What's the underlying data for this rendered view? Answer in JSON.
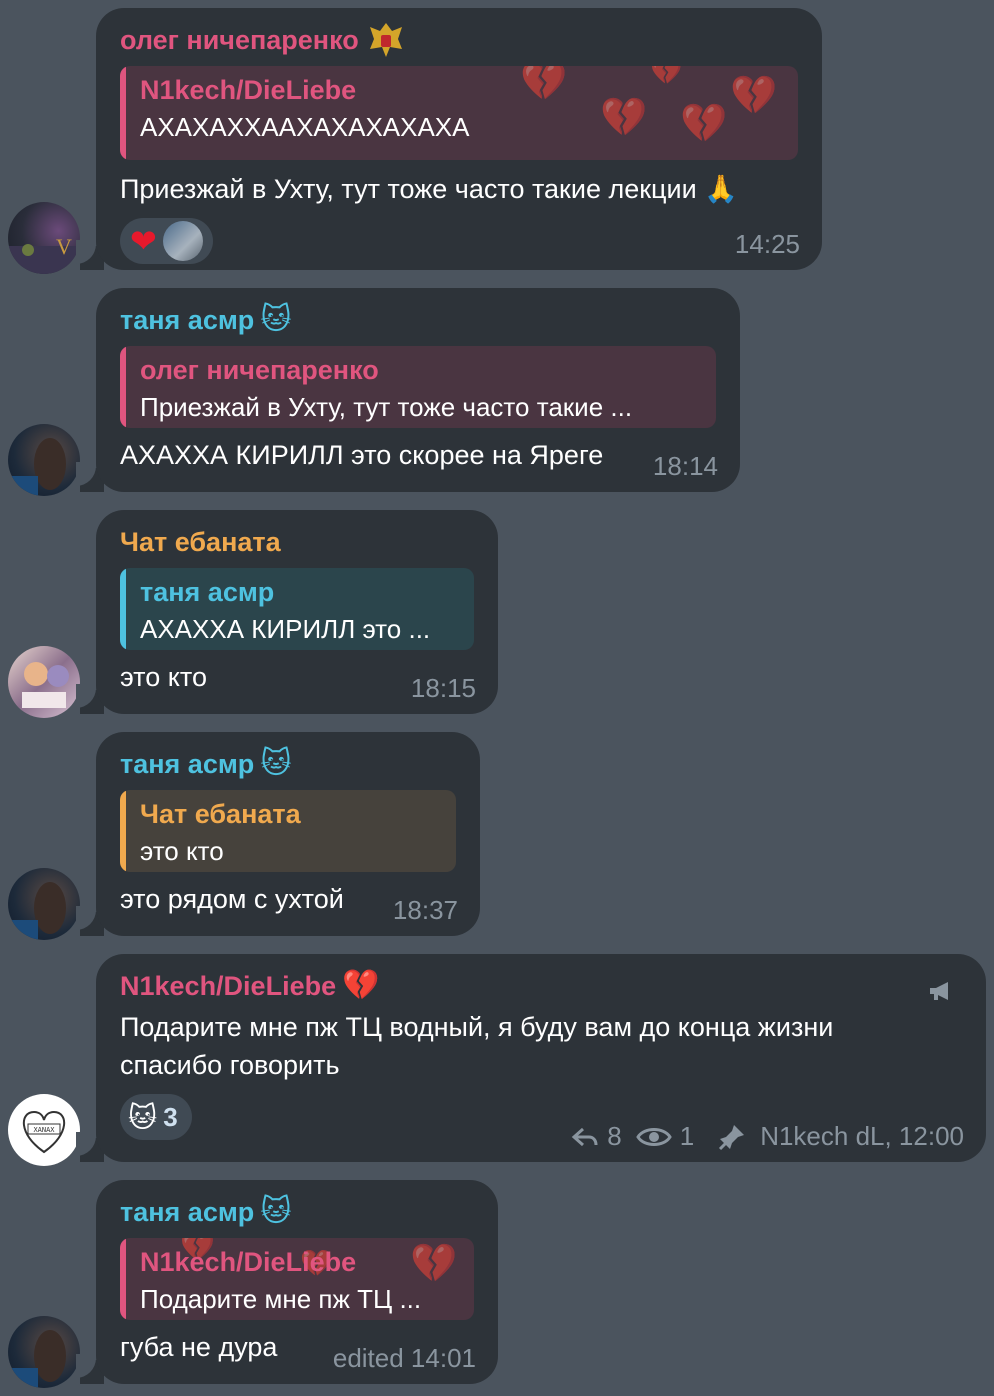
{
  "messages": [
    {
      "sender": "олег ничепаренко",
      "sender_badge": "russian-coat-of-arms",
      "reply_name": "N1kech/DieLiebe",
      "reply_text": "АХАХАХХААХАХАХАХАХА",
      "text": "Приезжай в Ухту, тут тоже часто такие лекции 🙏",
      "reaction": "❤",
      "time": "14:25"
    },
    {
      "sender": "таня асмр",
      "reply_name": "олег ничепаренко",
      "reply_text": "Приезжай в Ухту, тут тоже часто такие ...",
      "text": "АХАХХА КИРИЛЛ это скорее на Яреге",
      "time": "18:14"
    },
    {
      "sender": "Чат ебаната",
      "reply_name": "таня асмр",
      "reply_text": "АХАХХА КИРИЛЛ это ...",
      "text": "это кто",
      "time": "18:15"
    },
    {
      "sender": "таня асмр",
      "reply_name": "Чат ебаната",
      "reply_text": "это кто",
      "text": "это рядом с ухтой",
      "time": "18:37"
    },
    {
      "sender": "N1kech/DieLiebe",
      "sender_badge": "broken-heart",
      "line1": "Подарите мне пж ТЦ водный, я буду вам до конца жизни",
      "line2": "спасибо говорить",
      "reaction_count": "3",
      "reply_count": "8",
      "views": "1",
      "author_time": "N1kech dL, 12:00"
    },
    {
      "sender": "таня асмр",
      "reply_name": "N1kech/DieLiebe",
      "reply_text": "Подарите мне пж ТЦ ...",
      "text": "губа не дура",
      "time": "edited 14:01"
    }
  ],
  "icons": {
    "broken_heart": "💔",
    "hello_kitty": "🐱",
    "reply_arrow": "↩",
    "eye": "👁",
    "pin": "📌",
    "megaphone": "📢"
  },
  "colors": {
    "background": "#4b545e",
    "bubble": "#2d3339",
    "pink": "#e0557f",
    "cyan": "#4ec2e0",
    "orange": "#f0a94e",
    "meta": "#8a959f"
  }
}
